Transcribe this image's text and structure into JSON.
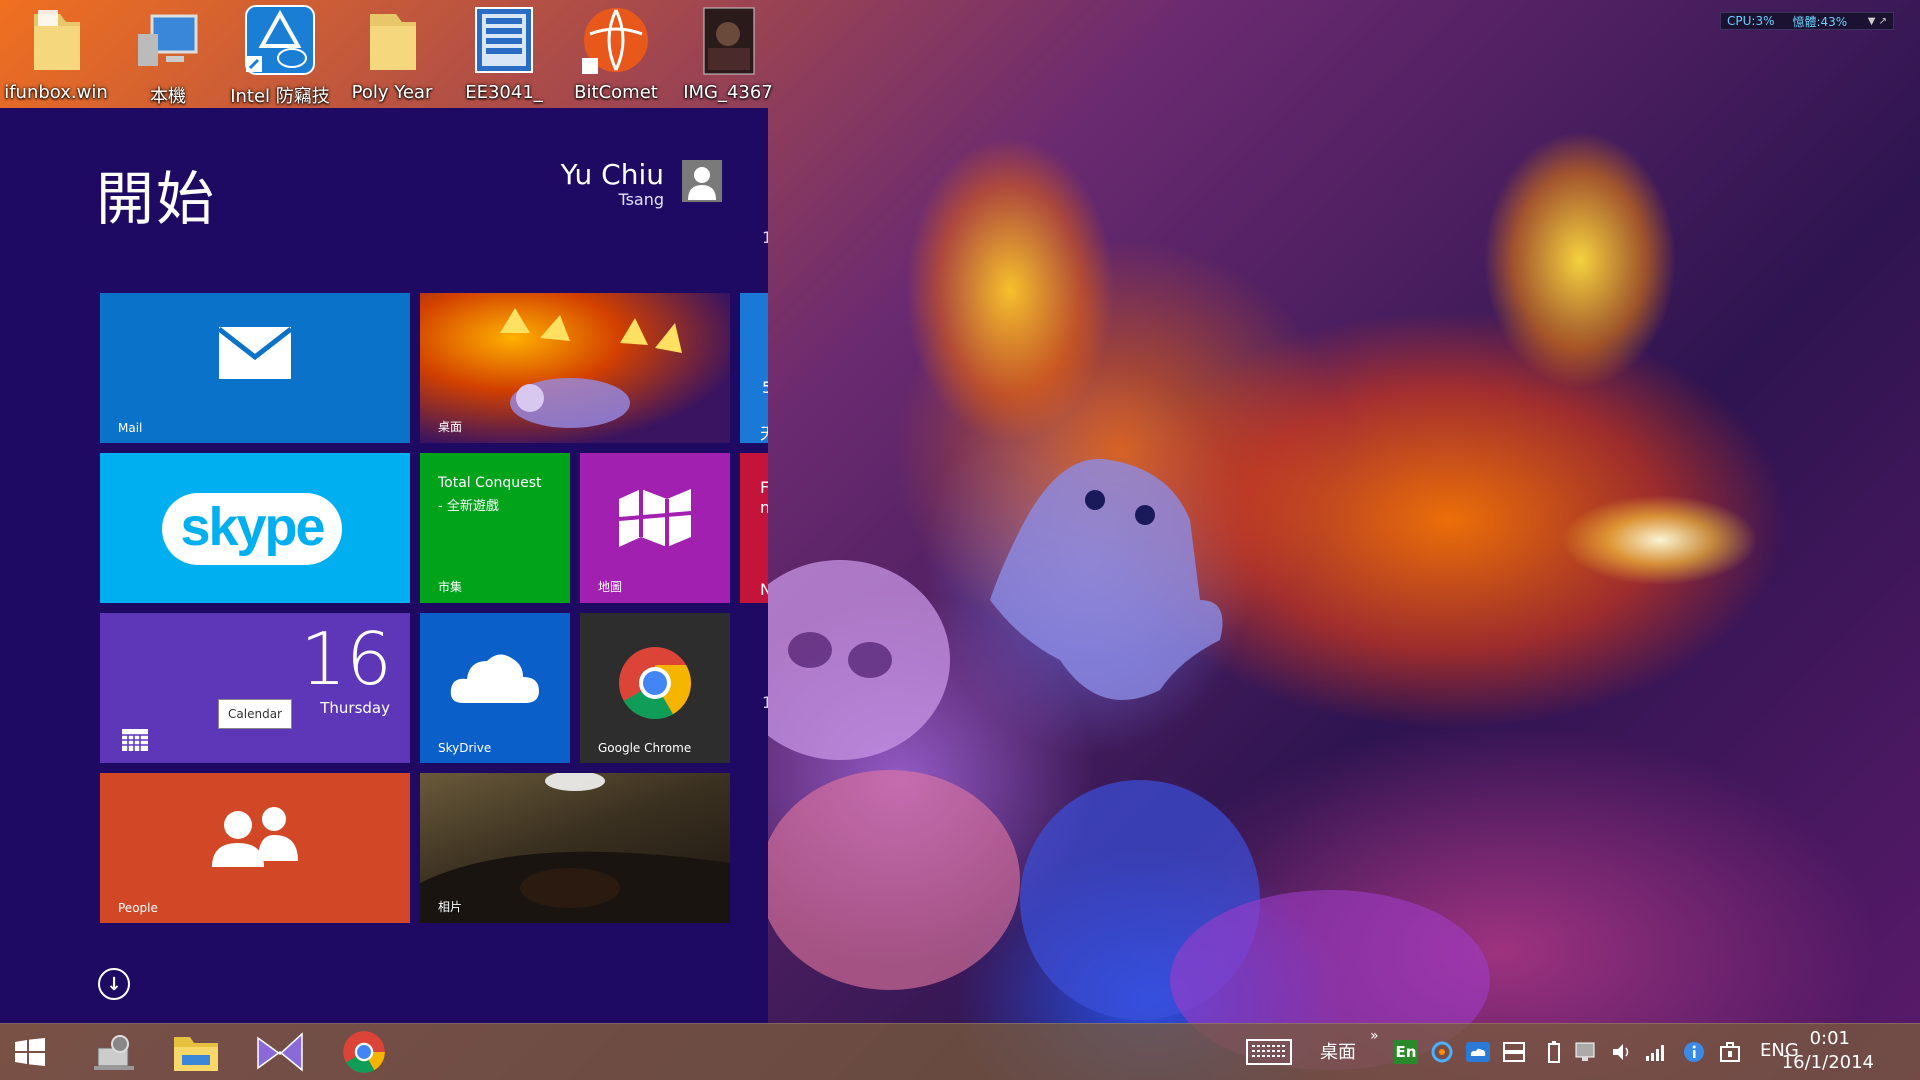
{
  "desktop_icons": [
    {
      "label": "ifunbox.win",
      "icon": "folder-icon"
    },
    {
      "label": "本機",
      "icon": "computer-icon"
    },
    {
      "label": "Intel 防竊技",
      "icon": "intel-antitheft-shortcut-icon"
    },
    {
      "label": "Poly Year",
      "icon": "folder-icon"
    },
    {
      "label": "EE3041_",
      "icon": "zip-archive-icon"
    },
    {
      "label": "BitComet",
      "icon": "bitcomet-shortcut-icon"
    },
    {
      "label": "IMG_4367",
      "icon": "image-thumbnail-icon"
    }
  ],
  "sysmon": {
    "cpu": "CPU:3%",
    "mem": "憶體:43%"
  },
  "start": {
    "title": "開始",
    "user_name": "Yu Chiu",
    "user_sub": "Tsang",
    "tiles": {
      "mail": "Mail",
      "desktop": "桌面",
      "skype_logo": "skype",
      "store_app": "Total Conquest",
      "store_app_sub": "- 全新遊戲",
      "store": "市集",
      "maps": "地圖",
      "calendar_day": "16",
      "calendar_weekday": "Thursday",
      "calendar_tooltip": "Calendar",
      "skydrive": "SkyDrive",
      "chrome": "Google Chrome",
      "people": "People",
      "photos": "相片"
    },
    "peek": {
      "p1": "1",
      "p2": "5",
      "p3": "天",
      "p4": "F",
      "p5": "n",
      "p6": "N",
      "p7": "1"
    }
  },
  "taskbar": {
    "apps": [
      {
        "name": "start-button"
      },
      {
        "name": "task-app"
      },
      {
        "name": "file-explorer"
      },
      {
        "name": "visual-studio"
      },
      {
        "name": "google-chrome"
      }
    ],
    "desktop_label": "桌面",
    "ime": "En",
    "lang": "ENG",
    "time": "0:01",
    "date": "16/1/2014"
  },
  "colors": {
    "start_bg": "#1e0a63",
    "mail": "#0a72c8",
    "skype": "#00aff0",
    "store": "#00a31a",
    "maps": "#a120b0",
    "calendar": "#5e36b8",
    "skydrive": "#0a5fc8",
    "chrome_tile": "#2d2d2d",
    "people": "#d24726"
  }
}
